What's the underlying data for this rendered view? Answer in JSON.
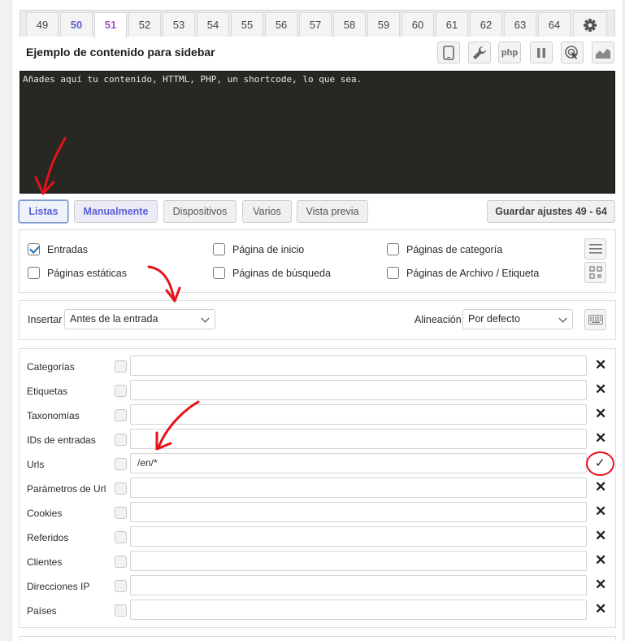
{
  "tabs": [
    "49",
    "50",
    "51",
    "52",
    "53",
    "54",
    "55",
    "56",
    "57",
    "58",
    "59",
    "60",
    "61",
    "62",
    "63",
    "64"
  ],
  "block_title": "Ejemplo de contenido para sidebar",
  "toolbar": {
    "php_label": "php"
  },
  "editor": {
    "content": "Añades aquí tu contenido, HTTML, PHP, un shortcode, lo que sea."
  },
  "buttons": {
    "listas": "Listas",
    "manualmente": "Manualmente",
    "dispositivos": "Dispositivos",
    "varios": "Varios",
    "vista_previa": "Vista previa",
    "guardar": "Guardar ajustes 49 - 64"
  },
  "checks": {
    "entradas": "Entradas",
    "paginas_estaticas": "Páginas estáticas",
    "pagina_inicio": "Página de inicio",
    "paginas_busqueda": "Páginas de búsqueda",
    "paginas_categoria": "Páginas de categoría",
    "paginas_archivo": "Páginas de Archivo / Etiqueta"
  },
  "insert": {
    "label": "Insertar",
    "value": "Antes de la entrada",
    "align_label": "Alineación",
    "align_value": "Por defecto"
  },
  "lists": [
    {
      "label": "Categorías",
      "value": ""
    },
    {
      "label": "Etiquetas",
      "value": ""
    },
    {
      "label": "Taxonomías",
      "value": ""
    },
    {
      "label": "IDs de entradas",
      "value": ""
    },
    {
      "label": "Urls",
      "value": "/en/*"
    },
    {
      "label": "Parámetros de Url",
      "value": ""
    },
    {
      "label": "Cookies",
      "value": ""
    },
    {
      "label": "Referidos",
      "value": ""
    },
    {
      "label": "Clientes",
      "value": ""
    },
    {
      "label": "Direcciones IP",
      "value": ""
    },
    {
      "label": "Países",
      "value": ""
    }
  ],
  "colors": {
    "accent": "#5b5fd6",
    "active_tab": "#a64ec6",
    "annotation": "#e5121a",
    "editor_bg": "#272822"
  }
}
